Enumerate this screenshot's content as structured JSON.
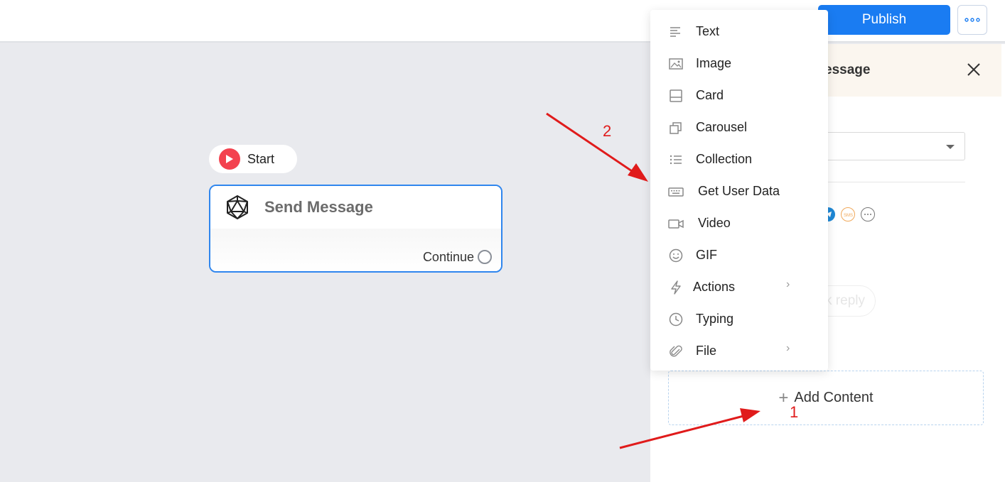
{
  "header": {
    "publish_label": "Publish"
  },
  "canvas": {
    "start_label": "Start",
    "node": {
      "title": "Send Message",
      "continue_label": "Continue"
    }
  },
  "panel": {
    "title": "essage",
    "quick_reply_label": "k reply",
    "add_content_label": "Add Content",
    "channel_icons": [
      "telegram-icon",
      "sms-icon",
      "chat-bubble-icon"
    ]
  },
  "menu": {
    "items": [
      {
        "label": "Text",
        "icon": "text-lines-icon",
        "has_submenu": false
      },
      {
        "label": "Image",
        "icon": "image-icon",
        "has_submenu": false
      },
      {
        "label": "Card",
        "icon": "card-icon",
        "has_submenu": false
      },
      {
        "label": "Carousel",
        "icon": "carousel-icon",
        "has_submenu": false
      },
      {
        "label": "Collection",
        "icon": "list-icon",
        "has_submenu": false
      },
      {
        "label": "Get User Data",
        "icon": "keyboard-icon",
        "has_submenu": false
      },
      {
        "label": "Video",
        "icon": "video-icon",
        "has_submenu": false
      },
      {
        "label": "GIF",
        "icon": "smiley-icon",
        "has_submenu": false
      },
      {
        "label": "Actions",
        "icon": "lightning-icon",
        "has_submenu": true
      },
      {
        "label": "Typing",
        "icon": "clock-icon",
        "has_submenu": false
      },
      {
        "label": "File",
        "icon": "paperclip-icon",
        "has_submenu": true
      }
    ]
  },
  "annotations": {
    "label_1": "1",
    "label_2": "2"
  },
  "colors": {
    "primary": "#1a7cf2",
    "start_red": "#f3424f",
    "annotation_red": "#e01b1b"
  }
}
